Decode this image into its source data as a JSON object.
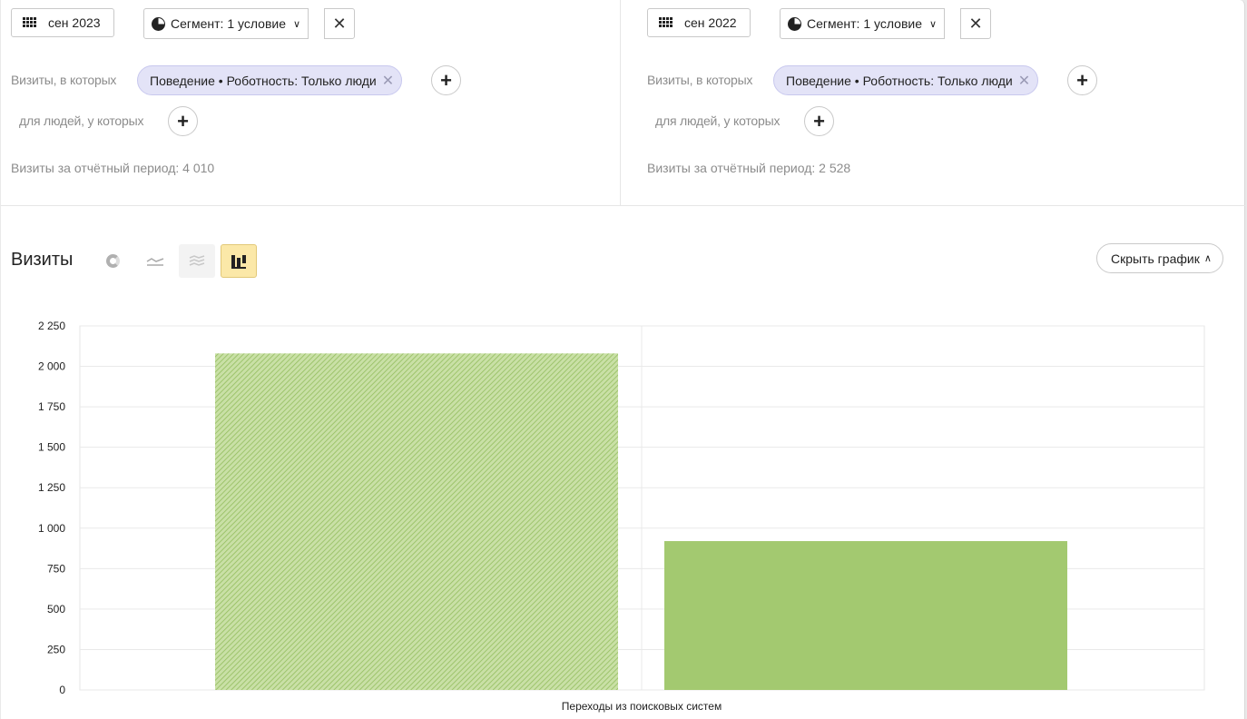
{
  "segments": [
    {
      "period": "сен 2023",
      "segment_label": "Сегмент: 1 условие",
      "visits_where_label": "Визиты, в которых",
      "condition_chip": "Поведение • Роботность: Только люди",
      "people_where_label": "для людей, у которых",
      "total_visits": "Визиты за отчётный период: 4 010"
    },
    {
      "period": "сен 2022",
      "segment_label": "Сегмент: 1 условие",
      "visits_where_label": "Визиты, в которых",
      "condition_chip": "Поведение • Роботность: Только люди",
      "people_where_label": "для людей, у которых",
      "total_visits": "Визиты за отчётный период: 2 528"
    }
  ],
  "chart_header": {
    "title": "Визиты",
    "hide_chart_label": "Скрыть график",
    "active_view": "bar"
  },
  "chart_data": {
    "type": "bar",
    "categories": [
      "Переходы из поисковых систем"
    ],
    "series": [
      {
        "values": [
          2080
        ],
        "color": "#a3c970",
        "pattern": "hatched"
      },
      {
        "values": [
          920
        ],
        "color": "#a3c970",
        "pattern": "solid"
      }
    ],
    "title": "",
    "xlabel": "",
    "ylabel": "",
    "ylim": [
      0,
      2250
    ],
    "yticks": [
      "0",
      "250",
      "500",
      "750",
      "1 000",
      "1 250",
      "1 500",
      "1 750",
      "2 000",
      "2 250"
    ],
    "grid": true
  }
}
